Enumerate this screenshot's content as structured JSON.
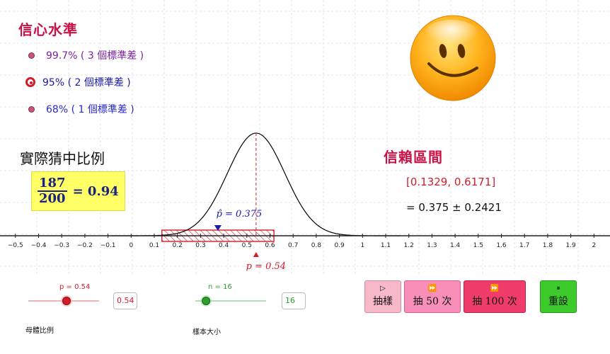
{
  "confidence": {
    "heading": "信心水準",
    "options": [
      {
        "label": "99.7% ( 3 個標準差 )",
        "color": "#7b1fa2",
        "selected": false
      },
      {
        "label": "95% ( 2 個標準差 )",
        "color": "#1a1aa6",
        "selected": true
      },
      {
        "label": "68% ( 1 個標準差 )",
        "color": "#2a2acc",
        "selected": false
      }
    ]
  },
  "actual": {
    "heading": "實際猜中比例",
    "numerator": "187",
    "denominator": "200",
    "result": "= 0.94"
  },
  "interval": {
    "heading": "信賴區間",
    "range": "[0.1329, 0.6171]",
    "expr": "= 0.375 ± 0.2421"
  },
  "chart_data": {
    "type": "line",
    "x_ticks": [
      "−0.5",
      "−0.4",
      "−0.3",
      "−0.2",
      "−0.1",
      "0",
      "0.1",
      "0.2",
      "0.3",
      "0.4",
      "0.5",
      "0.6",
      "0.7",
      "0.8",
      "0.9",
      "1",
      "1.1",
      "1.2",
      "1.3",
      "1.4",
      "1.5",
      "1.6",
      "1.7",
      "1.8",
      "1.9",
      "2"
    ],
    "xlim": [
      -0.53,
      2.08
    ],
    "curve": {
      "mean": 0.54,
      "sd": 0.1246
    },
    "p_hat": 0.375,
    "p_hat_label": "p̂ = 0.375",
    "p": 0.54,
    "p_label": "p = 0.54",
    "ci": [
      0.1329,
      0.6171
    ],
    "grid": true
  },
  "sliders": {
    "p": {
      "label": "p = 0.54",
      "value": 0.54,
      "value_text": "0.54",
      "caption": "母體比例"
    },
    "n": {
      "label": "n = 16",
      "value": 16,
      "value_text": "16",
      "caption": "樣本大小"
    }
  },
  "buttons": {
    "sample": "抽樣",
    "sample50": "抽 50 次",
    "sample100": "抽 100 次",
    "reset": "重設"
  },
  "colors": {
    "red": "#d31c2b",
    "blue": "#1a1aa6",
    "green": "#2e9e2e",
    "title": "#cc1144"
  }
}
